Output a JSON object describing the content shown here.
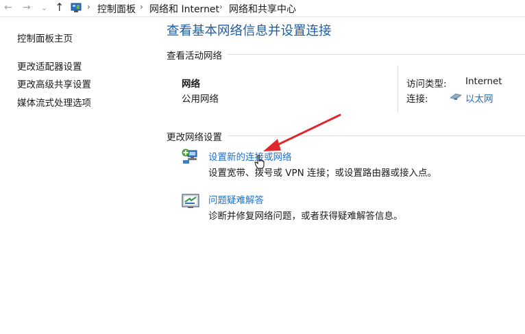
{
  "nav": {
    "back_glyph": "←",
    "forward_glyph": "→",
    "recent_glyph": "⌄",
    "up_glyph": "↑",
    "separator": "›",
    "breadcrumbs": [
      "控制面板",
      "网络和 Internet",
      "网络和共享中心"
    ]
  },
  "sidebar": {
    "items": [
      {
        "label": "控制面板主页"
      },
      {
        "label": "更改适配器设置"
      },
      {
        "label": "更改高级共享设置"
      },
      {
        "label": "媒体流式处理选项"
      }
    ]
  },
  "main": {
    "title": "查看基本网络信息并设置连接",
    "active_section": "查看活动网络",
    "network": {
      "name": "网络",
      "type": "公用网络",
      "access_type_label": "访问类型:",
      "access_type_value": "Internet",
      "connection_label": "连接:",
      "connection_value": "以太网"
    },
    "change_section": "更改网络设置",
    "tasks": [
      {
        "label": "设置新的连接或网络",
        "description": "设置宽带、拨号或 VPN 连接；或设置路由器或接入点。",
        "icon": "network-setup-icon"
      },
      {
        "label": "问题疑难解答",
        "description": "诊断并修复网络问题，或者获得疑难解答信息。",
        "icon": "troubleshoot-icon"
      }
    ]
  },
  "colors": {
    "title_blue": "#1e5fa8",
    "link_blue": "#1e6fc8",
    "annotation_arrow": "#e0282c"
  }
}
